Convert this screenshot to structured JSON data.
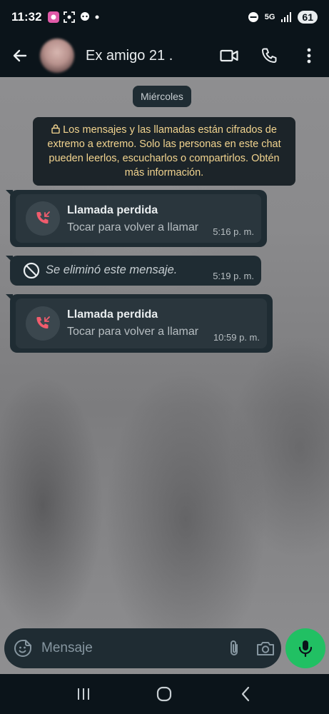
{
  "status_bar": {
    "time": "11:32",
    "network": "5G",
    "battery": "61"
  },
  "header": {
    "contact_name": "Ex amigo 21 .",
    "icons": [
      "arrow-back-icon",
      "video-call-icon",
      "phone-icon",
      "more-vertical-icon"
    ]
  },
  "chat": {
    "date_chip": "Miércoles",
    "encryption_notice": "Los mensajes y las llamadas están cifrados de extremo a extremo. Solo las personas en este chat pueden leerlos, escucharlos o compartirlos. Obtén más información.",
    "messages": [
      {
        "type": "missed-call",
        "title": "Llamada perdida",
        "subtitle": "Tocar para volver a llamar",
        "time": "5:16 p. m."
      },
      {
        "type": "deleted",
        "text": "Se eliminó este mensaje.",
        "time": "5:19 p. m."
      },
      {
        "type": "missed-call",
        "title": "Llamada perdida",
        "subtitle": "Tocar para volver a llamar",
        "time": "10:59 p. m."
      }
    ]
  },
  "composer": {
    "placeholder": "Mensaje",
    "icons": [
      "sticker-icon",
      "attach-icon",
      "camera-icon",
      "mic-icon"
    ]
  },
  "colors": {
    "accent": "#21c063",
    "missed_call": "#f15c6d",
    "notice_text": "#f2d48f"
  }
}
